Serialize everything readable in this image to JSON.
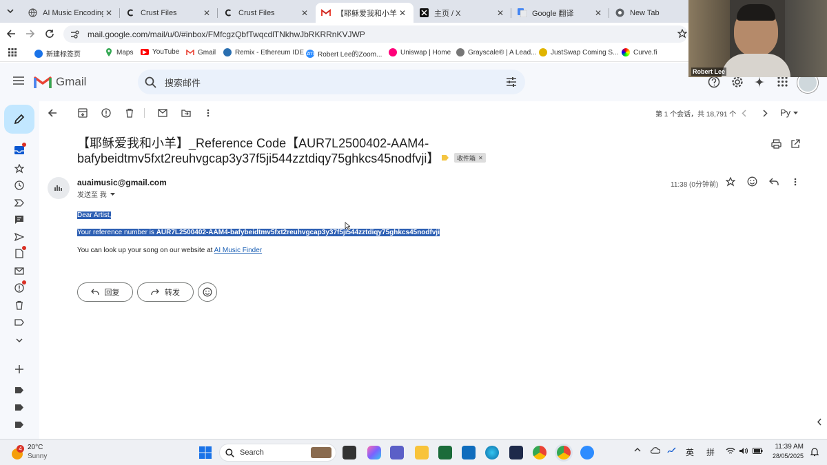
{
  "browser": {
    "tabs": [
      {
        "title": "AI Music Encoding R",
        "favicon": "globe-icon"
      },
      {
        "title": "Crust Files",
        "favicon": "crust-icon"
      },
      {
        "title": "Crust Files",
        "favicon": "crust-icon"
      },
      {
        "title": "【耶稣爱我和小羊】_R",
        "favicon": "gmail-icon"
      },
      {
        "title": "主页 / X",
        "favicon": "x-icon"
      },
      {
        "title": "Google 翻译",
        "favicon": "translate-icon"
      },
      {
        "title": "New Tab",
        "favicon": "chrome-icon"
      }
    ],
    "url": "mail.google.com/mail/u/0/#inbox/FMfcgzQbfTwqcdlTNkhwJbRKRRnKVJWP",
    "bookmarks": [
      {
        "label": "新建标签页"
      },
      {
        "label": "Maps"
      },
      {
        "label": "YouTube"
      },
      {
        "label": "Gmail"
      },
      {
        "label": "Remix - Ethereum IDE"
      },
      {
        "label": "Robert Lee的Zoom..."
      },
      {
        "label": "Uniswap | Home"
      },
      {
        "label": "Grayscale® | A Lead..."
      },
      {
        "label": "JustSwap Coming S..."
      },
      {
        "label": "Curve.fi"
      }
    ]
  },
  "gmail": {
    "logo_text": "Gmail",
    "search_placeholder": "搜索邮件",
    "pagination": "第 1 个会话，共 18,791 个",
    "language_indicator": "Рy",
    "email": {
      "subject": "【耶稣爱我和小羊】_Reference Code【AUR7L2500402-AAM4-bafybeidtmv5fxt2reuhvgcap3y37f5ji544zztdiqy75ghkcs45nodfvji】",
      "label": "收件箱",
      "sender": "auaimusic@gmail.com",
      "to": "发送至 我",
      "time": "11:38 (0分钟前)",
      "greeting": "Dear Artist,",
      "ref_prefix": "Your reference number is ",
      "ref_code": "AUR7L2500402-AAM4-bafybeidtmv5fxt2reuhvgcap3y37f5ji544zztdiqy75ghkcs45nodfvji",
      "lookup_text": "You can look up your song on our website at ",
      "lookup_link": "AI Music Finder",
      "reply_label": "回复",
      "forward_label": "转发"
    }
  },
  "taskbar": {
    "weather_badge": "4",
    "temperature": "20°C",
    "weather": "Sunny",
    "search_label": "Search",
    "ime_lang": "英",
    "ime_mode": "拼",
    "time": "11:39 AM",
    "date": "28/05/2025"
  },
  "video": {
    "name": "Robert Lee"
  },
  "colors": {
    "selection": "#2d5fb3",
    "gmail_bg": "#f6f8fc",
    "search_bg": "#eaf1fb",
    "link": "#1a5fb4",
    "label_arrow": "#f4c542",
    "notification_dot": "#d93025"
  }
}
